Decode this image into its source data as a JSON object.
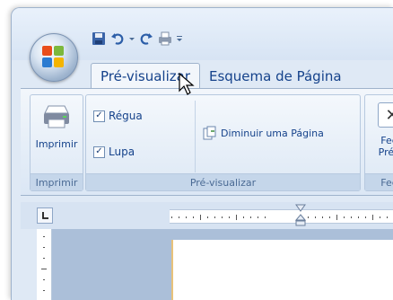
{
  "quick_access": {
    "icons": [
      "save-icon",
      "undo-icon",
      "dropdown-arrow-icon",
      "redo-icon",
      "print-icon",
      "customize-arrow-icon"
    ]
  },
  "tabs": [
    {
      "label": "Pré-visualizar",
      "active": true
    },
    {
      "label": "Esquema de Página",
      "active": false
    }
  ],
  "ribbon": {
    "print_group": {
      "button_label": "Imprimir",
      "group_label": "Imprimir"
    },
    "preview_group": {
      "checkboxes": [
        {
          "label": "Régua",
          "checked": true
        },
        {
          "label": "Lupa",
          "checked": true
        }
      ],
      "shrink_button_label": "Diminuir uma Página",
      "group_label": "Pré-visualizar"
    },
    "close_group": {
      "button_line1": "Fech",
      "button_line2": "Pré-vi",
      "group_label": "Fech"
    }
  },
  "colors": {
    "accent": "#15428b",
    "ribbon_bg": "#dbe7f5",
    "workspace": "#abbfd9"
  }
}
